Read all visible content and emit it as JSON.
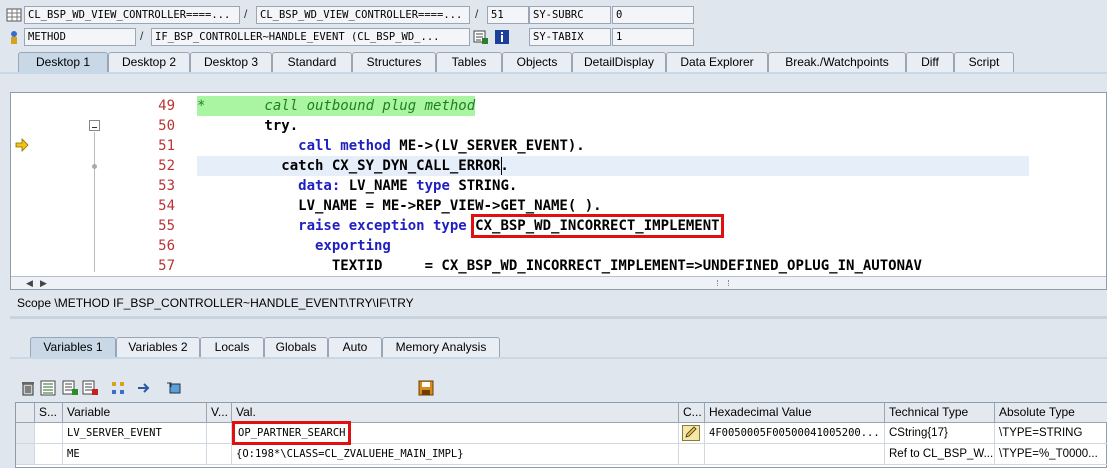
{
  "info": {
    "row1": {
      "program": "CL_BSP_WD_VIEW_CONTROLLER====...",
      "include": "CL_BSP_WD_VIEW_CONTROLLER====...",
      "line": "51",
      "sysvar_name": "SY-SUBRC",
      "sysvar_value": "0"
    },
    "row2": {
      "type": "METHOD",
      "name": "IF_BSP_CONTROLLER~HANDLE_EVENT (CL_BSP_WD_...",
      "sysvar_name": "SY-TABIX",
      "sysvar_value": "1"
    },
    "separator": "/"
  },
  "main_tabs": [
    {
      "label": "Desktop 1",
      "active": true
    },
    {
      "label": "Desktop 2"
    },
    {
      "label": "Desktop 3"
    },
    {
      "label": "Standard"
    },
    {
      "label": "Structures"
    },
    {
      "label": "Tables"
    },
    {
      "label": "Objects"
    },
    {
      "label": "DetailDisplay"
    },
    {
      "label": "Data Explorer"
    },
    {
      "label": "Break./Watchpoints"
    },
    {
      "label": "Diff"
    },
    {
      "label": "Script"
    }
  ],
  "code": {
    "lines": [
      {
        "n": "49",
        "text": "*       call outbound plug method"
      },
      {
        "n": "50",
        "text": "        try."
      },
      {
        "n": "51",
        "a": "            call method ",
        "b": "ME->(LV_SERVER_EVENT)."
      },
      {
        "n": "52",
        "a": "          catch ",
        "b": "CX_SY_DYN_CALL_ERROR."
      },
      {
        "n": "53",
        "a": "            data: ",
        "b": "LV_NAME ",
        "c": "type ",
        "d": "STRING."
      },
      {
        "n": "54",
        "text": "            LV_NAME = ME->REP_VIEW->GET_NAME( )."
      },
      {
        "n": "55",
        "a": "            raise exception type ",
        "b": "CX_BSP_WD_INCORRECT_IMPLEMENT"
      },
      {
        "n": "56",
        "text": "              exporting"
      },
      {
        "n": "57",
        "text": "                TEXTID     = CX_BSP_WD_INCORRECT_IMPLEMENT=>UNDEFINED_OPLUG_IN_AUTONAV"
      }
    ]
  },
  "scope": "Scope \\METHOD IF_BSP_CONTROLLER~HANDLE_EVENT\\TRY\\IF\\TRY",
  "var_tabs": [
    {
      "label": "Variables 1",
      "active": true
    },
    {
      "label": "Variables 2"
    },
    {
      "label": "Locals"
    },
    {
      "label": "Globals"
    },
    {
      "label": "Auto"
    },
    {
      "label": "Memory Analysis"
    }
  ],
  "grid": {
    "headers": [
      "S...",
      "Variable",
      "V...",
      "Val.",
      "C...",
      "Hexadecimal Value",
      "Technical Type",
      "Absolute Type"
    ],
    "rows": [
      {
        "variable": "LV_SERVER_EVENT",
        "value": "OP_PARTNER_SEARCH",
        "hex": "4F0050005F00500041005200...",
        "tech": "CString{17}",
        "abs": "\\TYPE=STRING"
      },
      {
        "variable": "ME",
        "value": "{O:198*\\CLASS=CL_ZVALUEHE_MAIN_IMPL}",
        "hex": "",
        "tech": "Ref to CL_BSP_W...",
        "abs": "\\TYPE=%_T0000..."
      }
    ]
  },
  "colors": {
    "highlight_box": "#e01010",
    "comment_bg": "#a9f5a1",
    "keyword": "#2020c0",
    "line_number": "#b33"
  }
}
